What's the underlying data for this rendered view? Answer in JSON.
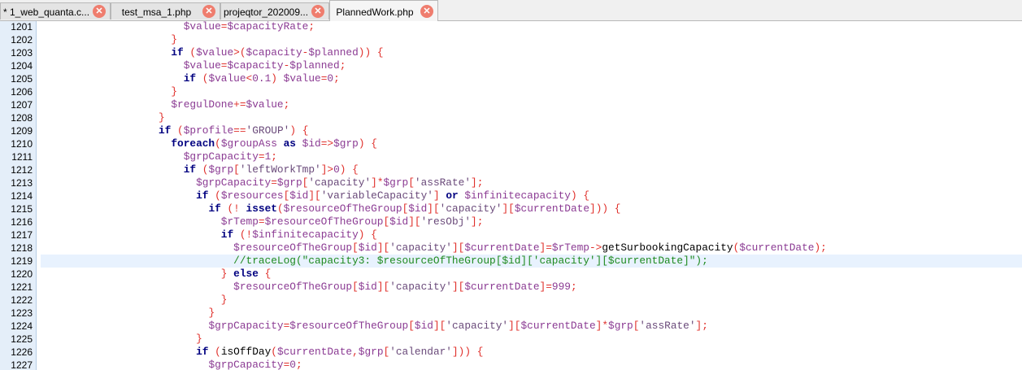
{
  "tabs": [
    {
      "label": "* 1_web_quanta.c...",
      "active": false
    },
    {
      "label": "test_msa_1.php",
      "active": false
    },
    {
      "label": "projeqtor_202009...",
      "active": false
    },
    {
      "label": "PlannedWork.php",
      "active": true
    }
  ],
  "close_glyph": "✕",
  "current_line": 1219,
  "lines": [
    {
      "n": "1201",
      "t": "    $value=$capacityRate;"
    },
    {
      "n": "1202",
      "t": "  }"
    },
    {
      "n": "1203",
      "t": "  if ($value>($capacity-$planned)) {"
    },
    {
      "n": "1204",
      "t": "    $value=$capacity-$planned;"
    },
    {
      "n": "1205",
      "t": "    if ($value<0.1) $value=0;"
    },
    {
      "n": "1206",
      "t": "  }"
    },
    {
      "n": "1207",
      "t": "  $regulDone+=$value;"
    },
    {
      "n": "1208",
      "t": "}"
    },
    {
      "n": "1209",
      "t": "if ($profile=='GROUP') {"
    },
    {
      "n": "1210",
      "t": "  foreach($groupAss as $id=>$grp) {"
    },
    {
      "n": "1211",
      "t": "    $grpCapacity=1;"
    },
    {
      "n": "1212",
      "t": "    if ($grp['leftWorkTmp']>0) {"
    },
    {
      "n": "1213",
      "t": "      $grpCapacity=$grp['capacity']*$grp['assRate'];"
    },
    {
      "n": "1214",
      "t": "      if ($resources[$id]['variableCapacity'] or $infinitecapacity) {"
    },
    {
      "n": "1215",
      "t": "        if (! isset($resourceOfTheGroup[$id]['capacity'][$currentDate])) {"
    },
    {
      "n": "1216",
      "t": "          $rTemp=$resourceOfTheGroup[$id]['resObj'];"
    },
    {
      "n": "1217",
      "t": "          if (!$infinitecapacity) {"
    },
    {
      "n": "1218",
      "t": "            $resourceOfTheGroup[$id]['capacity'][$currentDate]=$rTemp->getSurbookingCapacity($currentDate);"
    },
    {
      "n": "1219",
      "t": "            //traceLog(\"capacity3: $resourceOfTheGroup[$id]['capacity'][$currentDate]\");"
    },
    {
      "n": "1220",
      "t": "          } else {"
    },
    {
      "n": "1221",
      "t": "            $resourceOfTheGroup[$id]['capacity'][$currentDate]=999;"
    },
    {
      "n": "1222",
      "t": "          }"
    },
    {
      "n": "1223",
      "t": "        }"
    },
    {
      "n": "1224",
      "t": "        $grpCapacity=$resourceOfTheGroup[$id]['capacity'][$currentDate]*$grp['assRate'];"
    },
    {
      "n": "1225",
      "t": "      }"
    },
    {
      "n": "1226",
      "t": "      if (isOffDay($currentDate,$grp['calendar'])) {"
    },
    {
      "n": "1227",
      "t": "        $grpCapacity=0;"
    }
  ]
}
